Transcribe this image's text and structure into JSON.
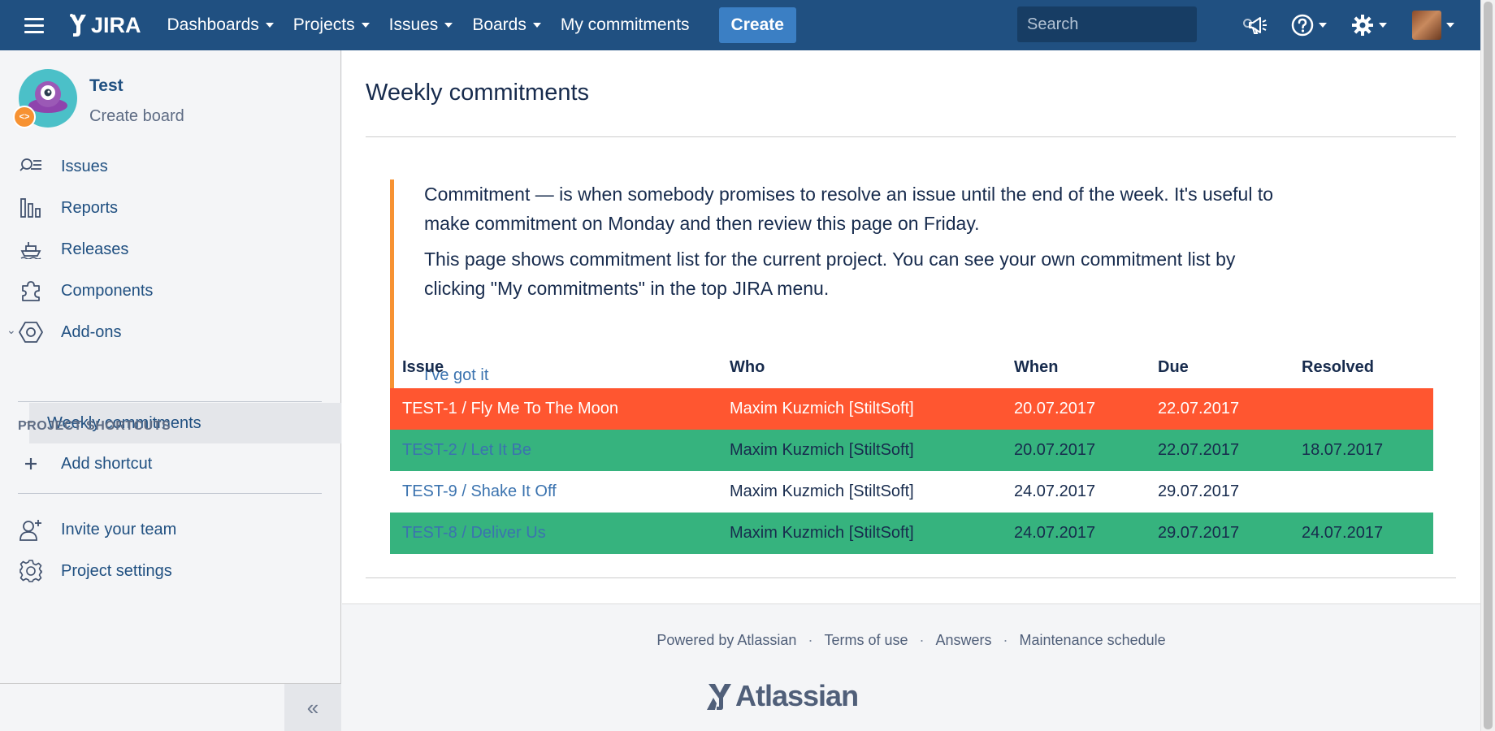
{
  "topnav": {
    "logo_text": "JIRA",
    "items": [
      {
        "label": "Dashboards",
        "has_caret": true
      },
      {
        "label": "Projects",
        "has_caret": true
      },
      {
        "label": "Issues",
        "has_caret": true
      },
      {
        "label": "Boards",
        "has_caret": true
      },
      {
        "label": "My commitments",
        "has_caret": false
      }
    ],
    "create_label": "Create",
    "search_placeholder": "Search",
    "icons": [
      "notifications-megaphone-icon",
      "help-icon",
      "settings-gear-icon",
      "user-avatar"
    ]
  },
  "sidebar": {
    "project_name": "Test",
    "project_sub": "Create board",
    "items": [
      {
        "label": "Issues",
        "icon": "issues-search-icon"
      },
      {
        "label": "Reports",
        "icon": "reports-chart-icon"
      },
      {
        "label": "Releases",
        "icon": "releases-ship-icon"
      },
      {
        "label": "Components",
        "icon": "components-puzzle-icon"
      },
      {
        "label": "Add-ons",
        "icon": "addons-hexagon-icon"
      }
    ],
    "sub_item": "Weekly commitments",
    "shortcuts_title": "PROJECT SHORTCUTS",
    "add_shortcut": "Add shortcut",
    "invite": "Invite your team",
    "settings": "Project settings",
    "collapse_glyph": "«"
  },
  "main": {
    "title": "Weekly commitments",
    "notice": {
      "p1": "Commitment — is when somebody promises to resolve an issue until the end of the week. It's useful to make commitment on Monday and then review this page on Friday.",
      "p2": "This page shows commitment list for the current project. You can see your own commitment list by clicking \"My commitments\" in the top JIRA menu.",
      "gotit": "I've got it"
    },
    "table": {
      "headers": [
        "Issue",
        "Who",
        "When",
        "Due",
        "Resolved"
      ],
      "rows": [
        {
          "issue": "TEST-1 / Fly Me To The Moon",
          "who": "Maxim Kuzmich [StiltSoft]",
          "when": "20.07.2017",
          "due": "22.07.2017",
          "resolved": "",
          "status": "overdue"
        },
        {
          "issue": "TEST-2 / Let It Be",
          "who": "Maxim Kuzmich [StiltSoft]",
          "when": "20.07.2017",
          "due": "22.07.2017",
          "resolved": "18.07.2017",
          "status": "resolved"
        },
        {
          "issue": "TEST-9 / Shake It Off",
          "who": "Maxim Kuzmich [StiltSoft]",
          "when": "24.07.2017",
          "due": "29.07.2017",
          "resolved": "",
          "status": "open"
        },
        {
          "issue": "TEST-8 / Deliver Us",
          "who": "Maxim Kuzmich [StiltSoft]",
          "when": "24.07.2017",
          "due": "29.07.2017",
          "resolved": "24.07.2017",
          "status": "resolved"
        }
      ]
    }
  },
  "footer": {
    "links": [
      "Powered by Atlassian",
      "Terms of use",
      "Answers",
      "Maintenance schedule"
    ],
    "separator": "·",
    "logo_text": "Atlassian"
  },
  "colors": {
    "nav_bg": "#205081",
    "create_bg": "#3b7fc4",
    "overdue_row": "#ff5630",
    "resolved_row": "#36b37e",
    "notice_border": "#f79232",
    "link": "#3b73af"
  }
}
